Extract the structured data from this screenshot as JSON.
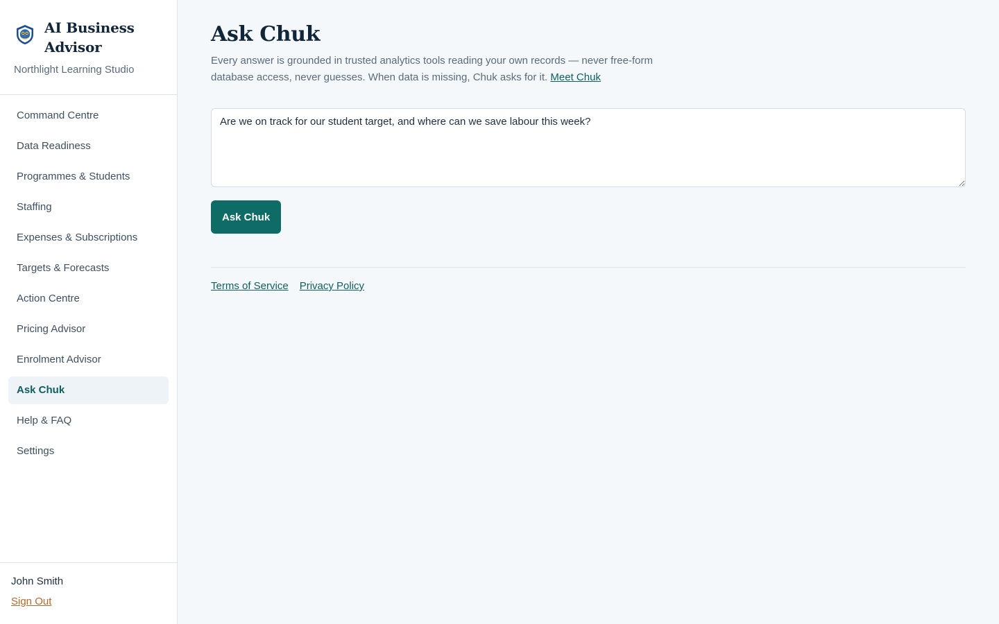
{
  "brand": {
    "title": "AI Business Advisor",
    "subtitle": "Northlight Learning Studio",
    "logo_icon": "shield-owl-icon"
  },
  "nav": {
    "items": [
      {
        "label": "Command Centre"
      },
      {
        "label": "Data Readiness"
      },
      {
        "label": "Programmes & Students"
      },
      {
        "label": "Staffing"
      },
      {
        "label": "Expenses & Subscriptions"
      },
      {
        "label": "Targets & Forecasts"
      },
      {
        "label": "Action Centre"
      },
      {
        "label": "Pricing Advisor"
      },
      {
        "label": "Enrolment Advisor"
      },
      {
        "label": "Ask Chuk"
      },
      {
        "label": "Help & FAQ"
      },
      {
        "label": "Settings"
      }
    ],
    "active": "Ask Chuk"
  },
  "user": {
    "name": "John Smith",
    "sign_out_label": "Sign Out"
  },
  "page": {
    "title": "Ask Chuk",
    "intro_text": "Every answer is grounded in trusted analytics tools reading your own records — never free-form database access, never guesses. When data is missing, Chuk asks for it. ",
    "intro_link": "Meet Chuk",
    "question_value": "Are we on track for our student target, and where can we save labour this week?",
    "ask_button_label": "Ask Chuk"
  },
  "footer": {
    "terms_label": "Terms of Service",
    "privacy_label": "Privacy Policy"
  },
  "colors": {
    "accent": "#0f6b66",
    "sign_out": "#b3692d",
    "heading": "#12263a",
    "background": "#f5f8fb"
  }
}
